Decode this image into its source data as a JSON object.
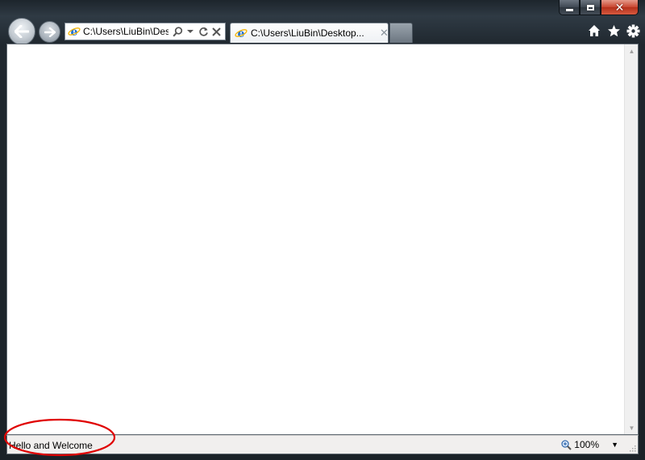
{
  "window": {
    "caption_buttons": [
      "minimize-icon",
      "maximize-icon",
      "close-icon"
    ]
  },
  "nav": {
    "back_icon": "arrow-left-icon",
    "forward_icon": "arrow-right-icon"
  },
  "address_bar": {
    "value": "C:\\Users\\LiuBin\\Desktop\\",
    "tools": [
      "search-icon",
      "dropdown-icon",
      "refresh-icon",
      "stop-icon"
    ]
  },
  "tabs": [
    {
      "title": "C:\\Users\\LiuBin\\Desktop...",
      "icon": "ie-icon"
    }
  ],
  "toolbar_right": [
    "home-icon",
    "favorites-star-icon",
    "gear-icon"
  ],
  "status_bar": {
    "text": "Hello and Welcome",
    "zoom": "100%"
  },
  "colors": {
    "frame": "#1f272e",
    "annotation": "#e00000",
    "close_button": "#c8452f",
    "ie_logo_blue": "#1d6fd0",
    "ie_logo_ring": "#f5b400"
  }
}
